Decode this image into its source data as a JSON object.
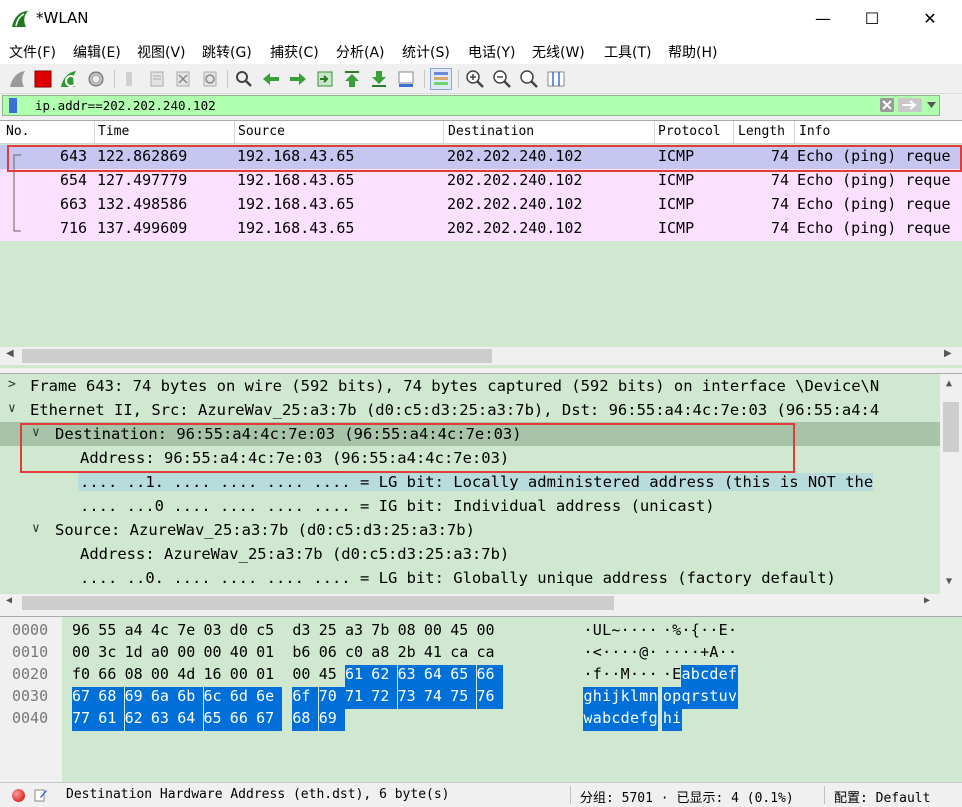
{
  "window": {
    "title": "*WLAN",
    "minimize": "—",
    "maximize": "☐",
    "close": "✕"
  },
  "menu": [
    "文件(F)",
    "编辑(E)",
    "视图(V)",
    "跳转(G)",
    "捕获(C)",
    "分析(A)",
    "统计(S)",
    "电话(Y)",
    "无线(W)",
    "工具(T)",
    "帮助(H)"
  ],
  "filter": {
    "value": "ip.addr==202.202.240.102"
  },
  "packet_list": {
    "columns": [
      "No.",
      "Time",
      "Source",
      "Destination",
      "Protocol",
      "Length",
      "Info"
    ],
    "rows": [
      {
        "no": "643",
        "time": "122.862869",
        "src": "192.168.43.65",
        "dst": "202.202.240.102",
        "proto": "ICMP",
        "len": "74",
        "info": "Echo (ping) reque"
      },
      {
        "no": "654",
        "time": "127.497779",
        "src": "192.168.43.65",
        "dst": "202.202.240.102",
        "proto": "ICMP",
        "len": "74",
        "info": "Echo (ping) reque"
      },
      {
        "no": "663",
        "time": "132.498586",
        "src": "192.168.43.65",
        "dst": "202.202.240.102",
        "proto": "ICMP",
        "len": "74",
        "info": "Echo (ping) reque"
      },
      {
        "no": "716",
        "time": "137.499609",
        "src": "192.168.43.65",
        "dst": "202.202.240.102",
        "proto": "ICMP",
        "len": "74",
        "info": "Echo (ping) reque"
      }
    ]
  },
  "details": [
    {
      "toggle": ">",
      "text": "Frame 643: 74 bytes on wire (592 bits), 74 bytes captured (592 bits) on interface \\Device\\N"
    },
    {
      "toggle": "∨",
      "text": "Ethernet II, Src: AzureWav_25:a3:7b (d0:c5:d3:25:a3:7b), Dst: 96:55:a4:4c:7e:03 (96:55:a4:4"
    },
    {
      "toggle": "∨",
      "text": "Destination: 96:55:a4:4c:7e:03 (96:55:a4:4c:7e:03)"
    },
    {
      "toggle": "",
      "text": "Address: 96:55:a4:4c:7e:03 (96:55:a4:4c:7e:03)"
    },
    {
      "toggle": "",
      "text": ".... ..1. .... .... .... .... = LG bit: Locally administered address (this is NOT the"
    },
    {
      "toggle": "",
      "text": ".... ...0 .... .... .... .... = IG bit: Individual address (unicast)"
    },
    {
      "toggle": "∨",
      "text": "Source: AzureWav_25:a3:7b (d0:c5:d3:25:a3:7b)"
    },
    {
      "toggle": "",
      "text": "Address: AzureWav_25:a3:7b (d0:c5:d3:25:a3:7b)"
    },
    {
      "toggle": "",
      "text": ".... ..0. .... .... .... .... = LG bit: Globally unique address (factory default)"
    }
  ],
  "bytes": [
    {
      "offset": "0000",
      "hex": [
        "96",
        "55",
        "a4",
        "4c",
        "7e",
        "03",
        "d0",
        "c5",
        "d3",
        "25",
        "a3",
        "7b",
        "08",
        "00",
        "45",
        "00"
      ],
      "ascii": [
        "·",
        "U",
        "L",
        "~",
        "·",
        "·",
        "·",
        "·",
        "·",
        "%",
        "·",
        "{",
        "·",
        "·",
        "E",
        "·"
      ]
    },
    {
      "offset": "0010",
      "hex": [
        "00",
        "3c",
        "1d",
        "a0",
        "00",
        "00",
        "40",
        "01",
        "b6",
        "06",
        "c0",
        "a8",
        "2b",
        "41",
        "ca",
        "ca"
      ],
      "ascii": [
        "·",
        "<",
        "·",
        "·",
        "·",
        "·",
        "@",
        "·",
        "·",
        "·",
        "·",
        "·",
        "+",
        "A",
        "·",
        "·"
      ]
    },
    {
      "offset": "0020",
      "hex": [
        "f0",
        "66",
        "08",
        "00",
        "4d",
        "16",
        "00",
        "01",
        "00",
        "45",
        "61",
        "62",
        "63",
        "64",
        "65",
        "66"
      ],
      "ascii": [
        "·",
        "f",
        "·",
        "·",
        "M",
        "·",
        "·",
        "·",
        "·",
        "E",
        "a",
        "b",
        "c",
        "d",
        "e",
        "f"
      ]
    },
    {
      "offset": "0030",
      "hex": [
        "67",
        "68",
        "69",
        "6a",
        "6b",
        "6c",
        "6d",
        "6e",
        "6f",
        "70",
        "71",
        "72",
        "73",
        "74",
        "75",
        "76"
      ],
      "ascii": [
        "g",
        "h",
        "i",
        "j",
        "k",
        "l",
        "m",
        "n",
        "o",
        "p",
        "q",
        "r",
        "s",
        "t",
        "u",
        "v"
      ]
    },
    {
      "offset": "0040",
      "hex": [
        "77",
        "61",
        "62",
        "63",
        "64",
        "65",
        "66",
        "67",
        "68",
        "69"
      ],
      "ascii": [
        "w",
        "a",
        "b",
        "c",
        "d",
        "e",
        "f",
        "g",
        "h",
        "i"
      ]
    }
  ],
  "status": {
    "field": "Destination Hardware Address (eth.dst), 6 byte(s)",
    "packets": "分组: 5701 · 已显示: 4 (0.1%)",
    "profile": "配置: Default"
  }
}
